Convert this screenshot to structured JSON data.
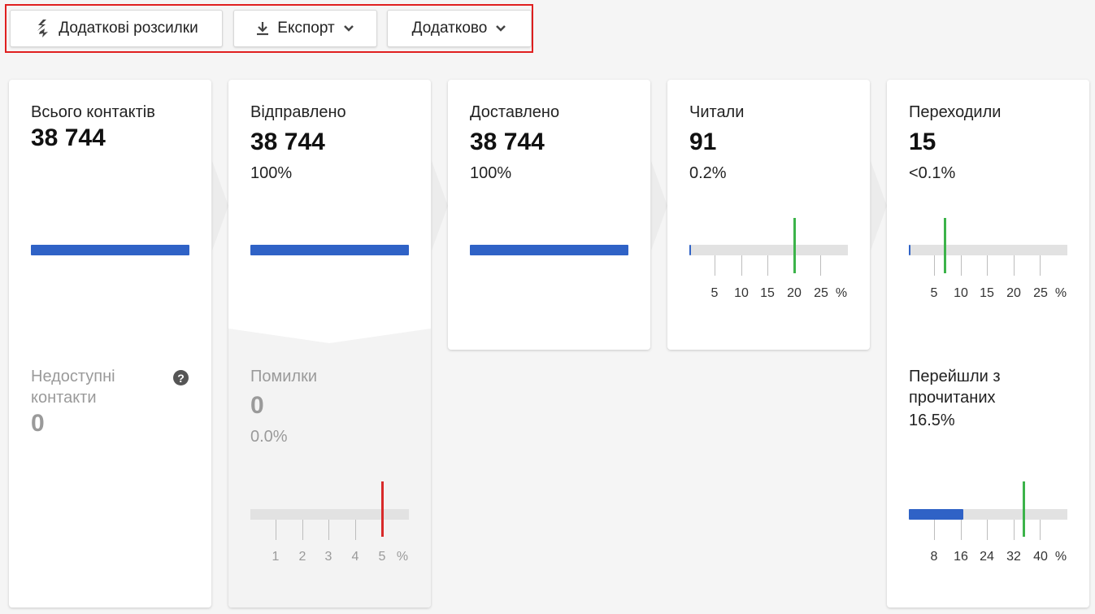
{
  "toolbar": {
    "more_mailings_label": "Додаткові розсилки",
    "export_label": "Експорт",
    "additional_label": "Додатково"
  },
  "cards": {
    "total": {
      "title": "Всього контактів",
      "value": "38 744"
    },
    "unavailable": {
      "title": "Недоступні контакти",
      "value": "0"
    },
    "sent": {
      "title": "Відправлено",
      "value": "38 744",
      "percent": "100%"
    },
    "errors": {
      "title": "Помилки",
      "value": "0",
      "percent": "0.0%",
      "ticks": [
        "1",
        "2",
        "3",
        "4",
        "5",
        "%"
      ]
    },
    "delivered": {
      "title": "Доставлено",
      "value": "38 744",
      "percent": "100%"
    },
    "read": {
      "title": "Читали",
      "value": "91",
      "percent": "0.2%",
      "ticks": [
        "5",
        "10",
        "15",
        "20",
        "25",
        "%"
      ]
    },
    "clicked": {
      "title": "Переходили",
      "value": "15",
      "percent": "<0.1%",
      "ticks": [
        "5",
        "10",
        "15",
        "20",
        "25",
        "%"
      ]
    },
    "clicked_of_read": {
      "title": "Перейшли з прочитаних",
      "percent": "16.5%",
      "ticks": [
        "8",
        "16",
        "24",
        "32",
        "40",
        "%"
      ]
    }
  },
  "colors": {
    "bar": "#2f62c6",
    "marker_good": "#3cb34a",
    "marker_bad": "#d82a2a",
    "highlight": "#e02020"
  },
  "icons": {
    "more_mailings": "lightning-arrows-icon",
    "export": "download-icon",
    "dropdown": "chevron-down-icon",
    "help": "question-circle-icon"
  }
}
